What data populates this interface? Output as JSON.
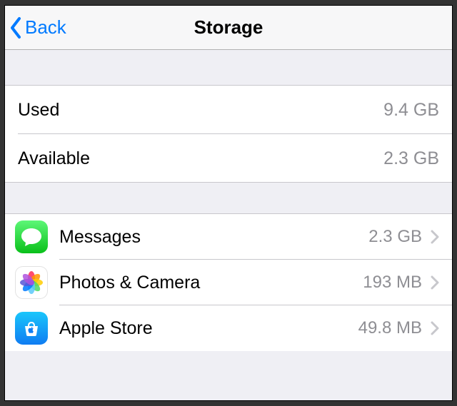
{
  "nav": {
    "back_label": "Back",
    "title": "Storage"
  },
  "summary": {
    "used_label": "Used",
    "used_value": "9.4 GB",
    "available_label": "Available",
    "available_value": "2.3 GB"
  },
  "apps": [
    {
      "name": "Messages",
      "size": "2.3 GB",
      "icon": "messages-icon"
    },
    {
      "name": "Photos & Camera",
      "size": "193 MB",
      "icon": "photos-icon"
    },
    {
      "name": "Apple Store",
      "size": "49.8 MB",
      "icon": "appstore-icon"
    }
  ]
}
